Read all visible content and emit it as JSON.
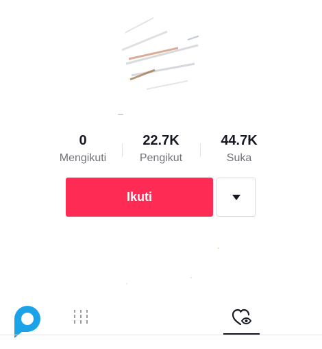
{
  "profile": {
    "stats": {
      "following": {
        "value": "0",
        "label": "Mengikuti"
      },
      "followers": {
        "value": "22.7K",
        "label": "Pengikut"
      },
      "likes": {
        "value": "44.7K",
        "label": "Suka"
      }
    },
    "follow_label": "Ikuti",
    "more_icon": "caret-down-icon",
    "accent_color": "#fe2c55"
  },
  "tabs": {
    "videos_icon": "grid-icon",
    "liked_icon": "liked-heart-icon",
    "active": "liked"
  },
  "logo_icon": "speech-bubble-logo-icon"
}
